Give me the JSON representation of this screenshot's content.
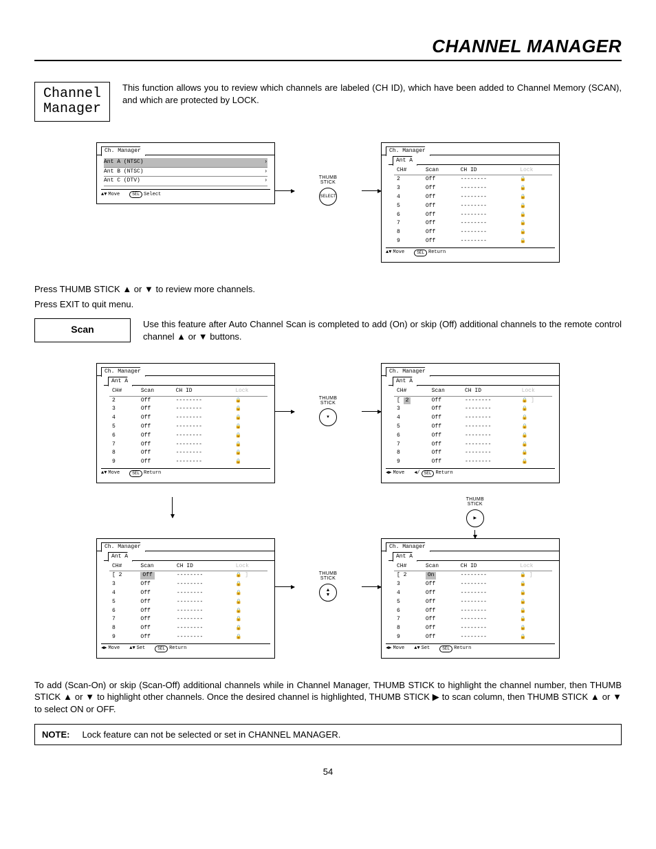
{
  "page_title": "CHANNEL MANAGER",
  "label_channel_manager": "Channel\nManager",
  "intro_text": "This function allows you to review which channels are labeled (CH ID), which have been added to Channel Memory (SCAN), and which are protected by LOCK.",
  "press_line1": "Press THUMB STICK ▲ or ▼ to review more channels.",
  "press_line2": "Press EXIT to quit menu.",
  "label_scan": "Scan",
  "scan_text": "Use this feature after Auto Channel Scan is completed to add (On) or skip (Off) additional channels to the remote control channel ▲ or ▼ buttons.",
  "to_add_text": "To add (Scan-On) or skip (Scan-Off) additional channels while in Channel Manager, THUMB STICK to highlight the channel number, then THUMB STICK ▲ or ▼ to highlight other channels.  Once the desired channel is highlighted, THUMB STICK ▶ to scan column, then THUMB STICK ▲ or ▼ to select ON or OFF.",
  "note_prefix": "NOTE:",
  "note_text": "Lock feature can not be selected or set in CHANNEL MANAGER.",
  "page_number": "54",
  "thumb_stick": "THUMB\nSTICK",
  "select_label": "SELECT",
  "osd": {
    "tab_main": "Ch. Manager",
    "tab_ant_a": "Ant A",
    "menu_items": [
      "Ant A (NTSC)",
      "Ant B (NTSC)",
      "Ant C (DTV)"
    ],
    "menu_footer_move": "Move",
    "menu_footer_select": "Select",
    "menu_footer_return": "Return",
    "menu_footer_set": "Set",
    "sel_pill": "SEL",
    "headers": [
      "CH#",
      "Scan",
      "CH ID",
      "Lock"
    ],
    "rows_off": [
      {
        "ch": "2",
        "scan": "Off",
        "id": "--------"
      },
      {
        "ch": "3",
        "scan": "Off",
        "id": "--------"
      },
      {
        "ch": "4",
        "scan": "Off",
        "id": "--------"
      },
      {
        "ch": "5",
        "scan": "Off",
        "id": "--------"
      },
      {
        "ch": "6",
        "scan": "Off",
        "id": "--------"
      },
      {
        "ch": "7",
        "scan": "Off",
        "id": "--------"
      },
      {
        "ch": "8",
        "scan": "Off",
        "id": "--------"
      },
      {
        "ch": "9",
        "scan": "Off",
        "id": "--------"
      }
    ],
    "rows_on_first": [
      {
        "ch": "2",
        "scan": "On",
        "id": "--------"
      },
      {
        "ch": "3",
        "scan": "Off",
        "id": "--------"
      },
      {
        "ch": "4",
        "scan": "Off",
        "id": "--------"
      },
      {
        "ch": "5",
        "scan": "Off",
        "id": "--------"
      },
      {
        "ch": "6",
        "scan": "Off",
        "id": "--------"
      },
      {
        "ch": "7",
        "scan": "Off",
        "id": "--------"
      },
      {
        "ch": "8",
        "scan": "Off",
        "id": "--------"
      },
      {
        "ch": "9",
        "scan": "Off",
        "id": "--------"
      }
    ]
  }
}
